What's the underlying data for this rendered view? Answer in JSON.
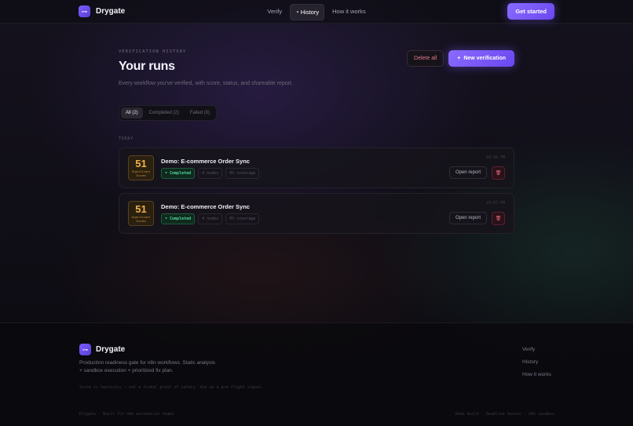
{
  "nav": {
    "brand": "Drygate",
    "logo_glyph": "⊶",
    "links": [
      {
        "label": "Verify"
      },
      {
        "label": "History",
        "icon": "clock-icon"
      },
      {
        "label": "How it works"
      }
    ],
    "cta": "Get started"
  },
  "header": {
    "eyebrow": "VERIFICATION HISTORY",
    "title": "Your runs",
    "subtitle": "Every workflow you've verified, with score, status, and shareable report.",
    "delete_all": "Delete all",
    "new_verification": "New verification"
  },
  "filters": [
    "All (2)",
    "Completed (2)",
    "Failed (0)"
  ],
  "group_label": "TODAY",
  "runs": [
    {
      "score": "51",
      "score_label_1": "Significant",
      "score_label_2": "Issues",
      "title": "Demo: E-commerce Order Sync",
      "status": "• Completed",
      "nodes": "4 nodes",
      "coverage": "0% coverage",
      "time": "10:36 PM",
      "open": "Open report"
    },
    {
      "score": "51",
      "score_label_1": "Significant",
      "score_label_2": "Issues",
      "title": "Demo: E-commerce Order Sync",
      "status": "• Completed",
      "nodes": "4 nodes",
      "coverage": "0% coverage",
      "time": "10:07 PM",
      "open": "Open report"
    }
  ],
  "footer": {
    "brand": "Drygate",
    "description": "Production readiness gate for n8n workflows. Static analysis + sandbox execution + prioritized fix plan.",
    "note": "Score is heuristic — not a formal proof of safety. Use as a pre-flight signal.",
    "links": [
      "Verify",
      "History",
      "How it works"
    ],
    "bottom_left": "Drygate · Built for n8n automation teams",
    "bottom_right": "Demo build · Deadline Sensor · n8n sandbox"
  },
  "colors": {
    "accent": "#7c5cff",
    "success": "#4fd69a",
    "warning": "#f0b04a",
    "danger": "#e06a7e"
  }
}
